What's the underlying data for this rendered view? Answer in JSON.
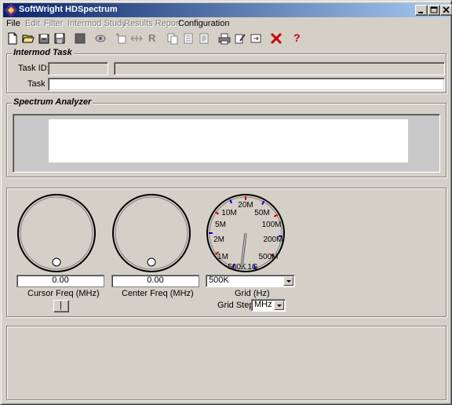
{
  "window": {
    "title": "SoftWright HDSpectrum",
    "minimize": "_",
    "maximize": "□",
    "close": "×"
  },
  "menu": [
    {
      "label": "File",
      "enabled": true
    },
    {
      "label": "Edit",
      "enabled": false
    },
    {
      "label": "Filter",
      "enabled": false
    },
    {
      "label": "Intermod Study",
      "enabled": false
    },
    {
      "label": "Results Report",
      "enabled": false
    },
    {
      "label": "Configuration",
      "enabled": true
    }
  ],
  "toolbar": {
    "r_button": "R",
    "help": "?"
  },
  "intermod_task": {
    "title": "Intermod Task",
    "task_id_label": "Task ID:",
    "task_id_value": "",
    "task_label": "Task",
    "task_value": ""
  },
  "spectrum_analyzer": {
    "title": "Spectrum Analyzer"
  },
  "controls": {
    "cursor_freq": {
      "value": "0.00",
      "label": "Cursor Freq (MHz)",
      "button": "|"
    },
    "center_freq": {
      "value": "0.00",
      "label": "Center Freq (MHz)"
    },
    "grid": {
      "selected": "500K",
      "label": "Grid (Hz)",
      "dial_labels": [
        "500K",
        "1M",
        "2M",
        "5M",
        "10M",
        "20M",
        "50M",
        "100M",
        "200M",
        "500M",
        "1G"
      ]
    },
    "grid_step": {
      "label": "Grid Step",
      "selected": "MHz"
    }
  },
  "colors": {
    "title_start": "#0a246a",
    "title_end": "#a6caf0",
    "face": "#d4d0c8",
    "close_icon": "#cc0000",
    "dial_tick_red": "#cc0000",
    "dial_tick_blue": "#0000cc"
  }
}
